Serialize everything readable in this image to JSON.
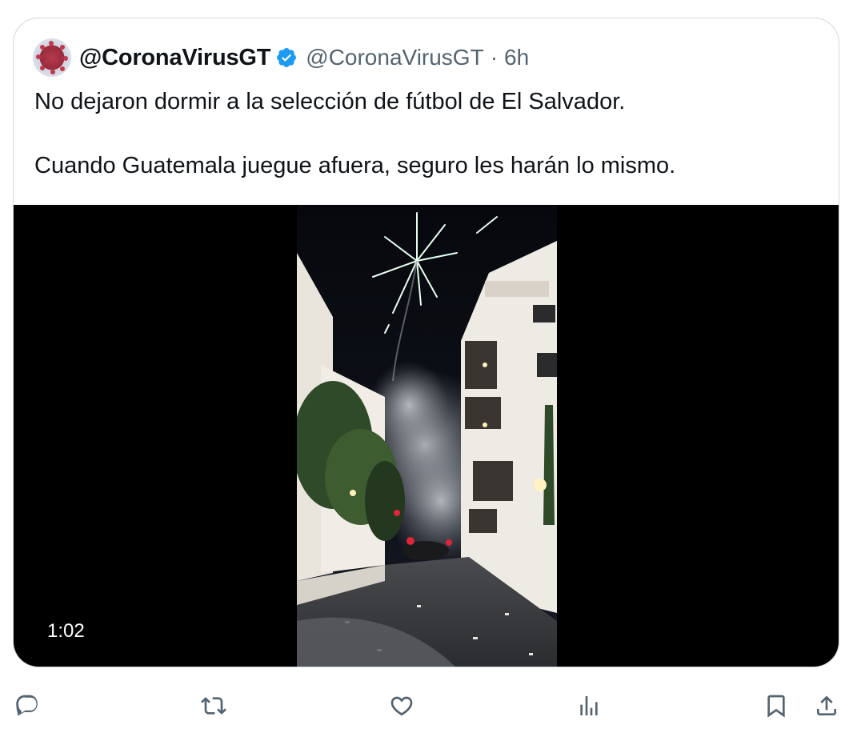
{
  "tweet": {
    "display_name": "@CoronaVirusGT",
    "handle": "@CoronaVirusGT",
    "separator": "·",
    "time": "6h",
    "text_line_1": "No dejaron dormir a la selección de fútbol de El Salvador.",
    "text_line_2": "Cuando Guatemala juegue afuera, seguro les harán lo mismo."
  },
  "media": {
    "type": "video",
    "duration": "1:02"
  },
  "actions": [
    {
      "icon": "reply-icon"
    },
    {
      "icon": "retweet-icon"
    },
    {
      "icon": "like-icon"
    },
    {
      "icon": "views-icon"
    },
    {
      "icon": "bookmark-icon"
    },
    {
      "icon": "share-icon"
    }
  ],
  "colors": {
    "text": "#0f1419",
    "secondary": "#536471",
    "border": "#cfd9de",
    "verified": "#1d9bf0"
  }
}
